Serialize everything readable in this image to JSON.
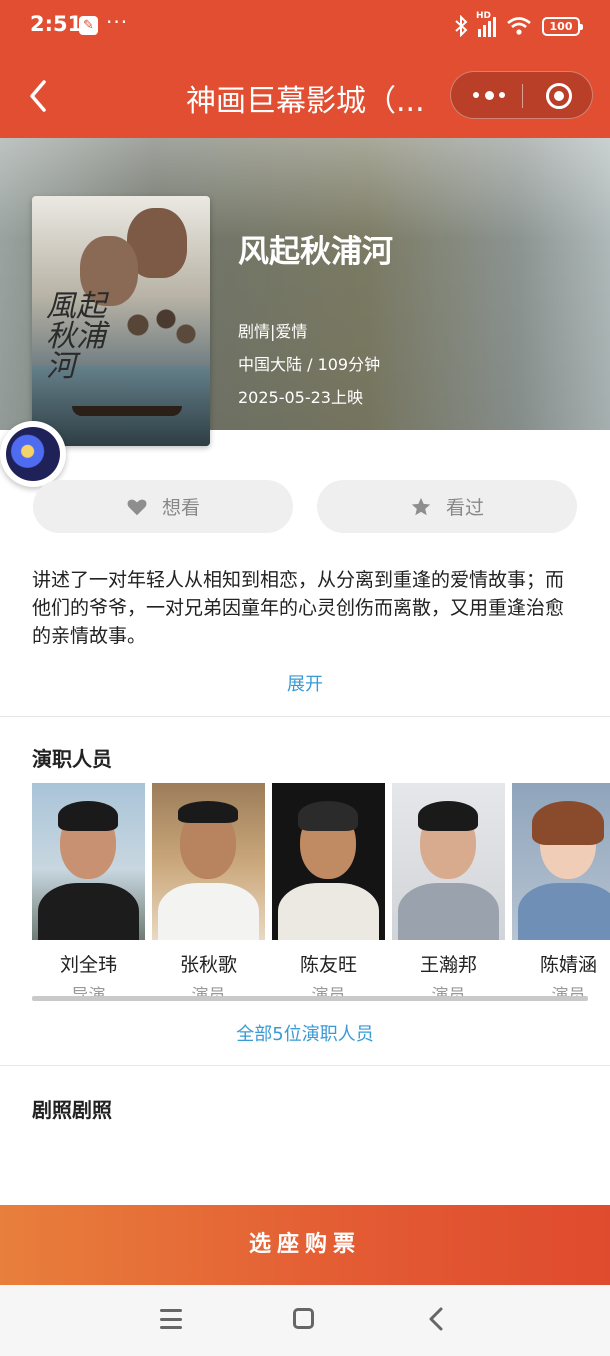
{
  "status_bar": {
    "time": "2:51",
    "more": "···",
    "signal": "HD",
    "battery": "100"
  },
  "nav": {
    "title": "神画巨幕影城（..."
  },
  "movie": {
    "title": "风起秋浦河",
    "poster_calligraphy": "風起秋浦河",
    "genre": "剧情|爱情",
    "region_duration": "中国大陆 / 109分钟",
    "release": "2025-05-23上映"
  },
  "actions": {
    "want": "想看",
    "seen": "看过"
  },
  "synopsis": {
    "text": "讲述了一对年轻人从相知到相恋，从分离到重逢的爱情故事；而他们的爷爷，一对兄弟因童年的心灵创伤而离散，又用重逢治愈的亲情故事。",
    "expand": "展开"
  },
  "cast_section": {
    "title": "演职人员",
    "members": [
      {
        "name": "刘全玮",
        "role": "导演"
      },
      {
        "name": "张秋歌",
        "role": "演员"
      },
      {
        "name": "陈友旺",
        "role": "演员"
      },
      {
        "name": "王瀚邦",
        "role": "演员"
      },
      {
        "name": "陈婧涵",
        "role": "演员"
      }
    ],
    "all_link": "全部5位演职人员"
  },
  "stills_section": {
    "title": "剧照剧照"
  },
  "buy_button": "选座购票",
  "colors": {
    "brand": "#e24e31",
    "link": "#3a9ad6",
    "button_bg": "#efefef"
  }
}
